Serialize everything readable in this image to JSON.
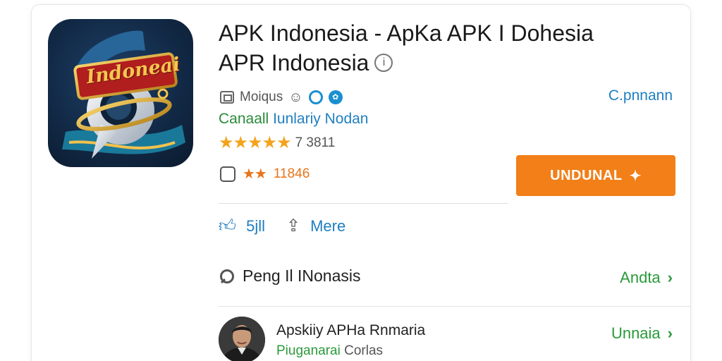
{
  "app": {
    "title_line1": "APK Indonesia - ApKa APK I Dohesia",
    "title_line2": "APR Indonesia",
    "icon_text": "Indoneai",
    "meta_label": "Moiqus",
    "right_link": "C.pnnann",
    "developer_part1": "Canaall",
    "developer_part2": "Iunlariy Nodan",
    "rating_stars": "★★★★★",
    "rating_value": 4.5,
    "rating_text": "7 3811",
    "downloads_stars": "★★",
    "downloads_text": "11846",
    "install_label": "UNDUNAL"
  },
  "actions": {
    "like_count": "5jll",
    "share_label": "Mere"
  },
  "search": {
    "label": "Peng Il INonasis",
    "link": "Andta"
  },
  "review": {
    "name": "Apskiiy APHa Rnmaria",
    "sub_a": "Piuganarai",
    "sub_b": "Corlas",
    "link": "Unnaia"
  },
  "colors": {
    "accent_orange": "#f27f18",
    "link_blue": "#1f7fc0",
    "link_green": "#2a9a3a",
    "star_gold": "#f3a41c"
  },
  "icons": [
    "info-icon",
    "meta-box-icon",
    "face-icon",
    "badge-icon",
    "star-icon",
    "square-icon",
    "download-icon",
    "thumb-up-icon",
    "share-icon",
    "search-icon",
    "chevron-right-icon"
  ]
}
